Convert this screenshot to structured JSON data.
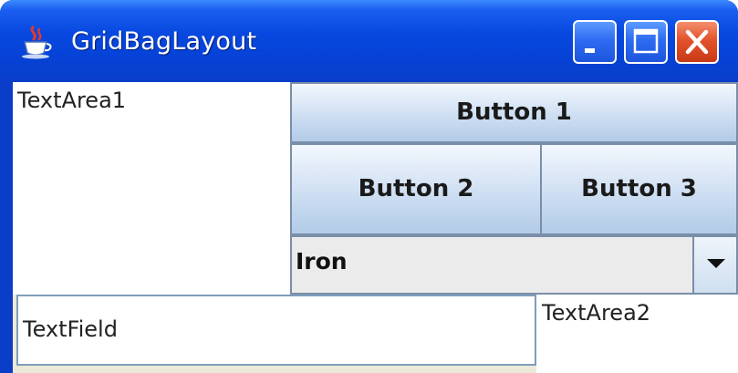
{
  "window": {
    "title": "GridBagLayout",
    "app_icon": "java-coffee-cup-icon",
    "controls": {
      "minimize_icon": "minimize-icon",
      "maximize_icon": "maximize-icon",
      "close_icon": "close-icon"
    },
    "colors": {
      "titlebar": "#0a3ec9",
      "close_button": "#e2522b",
      "client_background": "#ece9d8"
    }
  },
  "content": {
    "textarea1": "TextArea1",
    "button1": "Button 1",
    "button2": "Button 2",
    "button3": "Button 3",
    "combo": {
      "selected": "Iron",
      "arrow_icon": "chevron-down-icon"
    },
    "textfield": "TextField",
    "textarea2": "TextArea2"
  }
}
